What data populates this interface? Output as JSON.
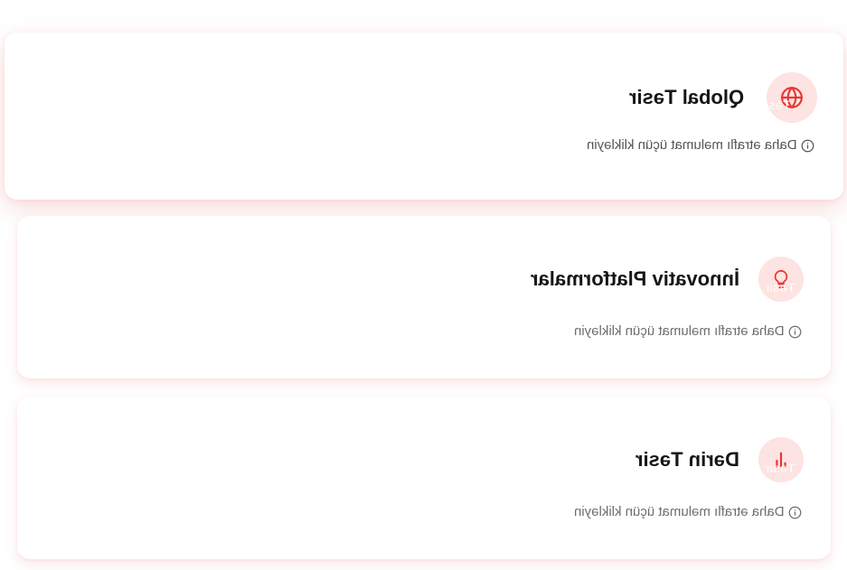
{
  "colors": {
    "accent": "#e53935",
    "icon_background": "#fde3e2",
    "title_text": "#161616",
    "hint_text": "#6e6e6e"
  },
  "cards": [
    {
      "title": "Qlobal Təsir",
      "hint": "Daha ətraflı məlumat üçün klikləyin",
      "icon": "globe-icon",
      "icon_overlay": "Təsir"
    },
    {
      "title": "İnnovativ Platformalar",
      "hint": "Daha ətraflı məlumat üçün klikləyin",
      "icon": "lightbulb-icon",
      "icon_overlay": "Təsir"
    },
    {
      "title": "Dərin Təsir",
      "hint": "Daha ətraflı məlumat üçün klikləyin",
      "icon": "bar-chart-icon",
      "icon_overlay": "Təsir"
    }
  ]
}
